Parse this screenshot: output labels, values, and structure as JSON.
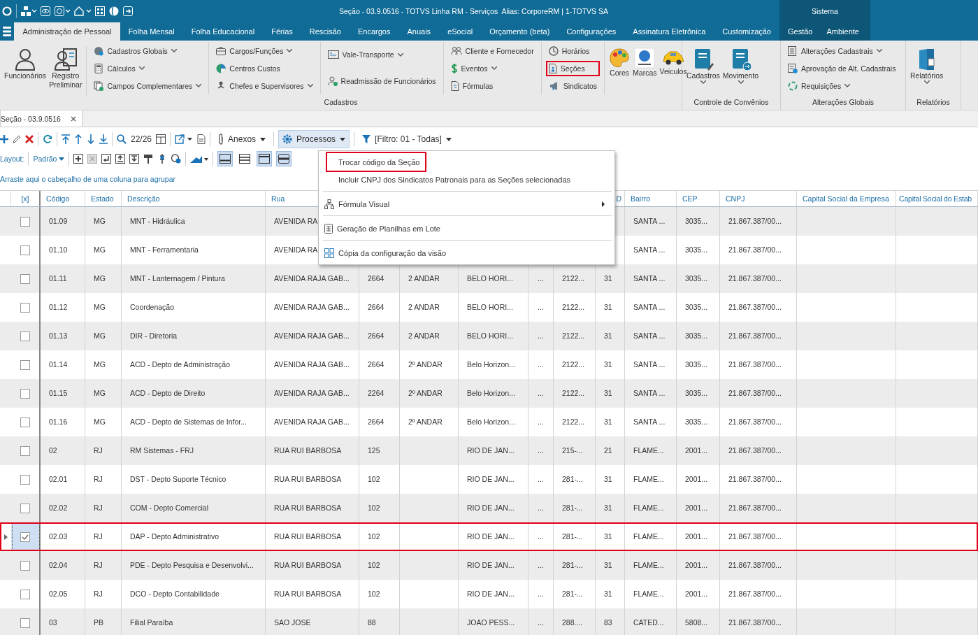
{
  "title_bar": {
    "title": "Seção - 03.9.0516 - TOTVS Linha RM - Serviços  Alias: CorporeRM | 1-TOTVS SA",
    "system_label": "Sistema"
  },
  "ribbon_tabs": [
    {
      "label": "Administração de Pessoal",
      "selected": true
    },
    {
      "label": "Folha Mensal",
      "selected": false
    },
    {
      "label": "Folha Educacional",
      "selected": false
    },
    {
      "label": "Férias",
      "selected": false
    },
    {
      "label": "Rescisão",
      "selected": false
    },
    {
      "label": "Encargos",
      "selected": false
    },
    {
      "label": "Anuais",
      "selected": false
    },
    {
      "label": "eSocial",
      "selected": false
    },
    {
      "label": "Orçamento (beta)",
      "selected": false
    },
    {
      "label": "Configurações",
      "selected": false
    },
    {
      "label": "Assinatura Eletrônica",
      "selected": false
    },
    {
      "label": "Customização",
      "selected": false
    }
  ],
  "system_tabs": [
    {
      "label": "Gestão",
      "selected": false
    },
    {
      "label": "Ambiente",
      "selected": false
    }
  ],
  "ribbon_groups": [
    {
      "label": "Cadastros",
      "sections": [
        {
          "kind": "large",
          "items": [
            {
              "label": "Funcionários",
              "dropdown": false,
              "highlighted": false
            },
            {
              "label": "Registro Preliminar",
              "dropdown": false,
              "highlighted": false
            }
          ]
        },
        {
          "kind": "stack",
          "items": [
            {
              "label": "Cadastros Globais",
              "dropdown": true,
              "highlighted": false
            },
            {
              "label": "Cálculos",
              "dropdown": true,
              "highlighted": false
            },
            {
              "label": "Campos Complementares",
              "dropdown": true,
              "highlighted": false
            }
          ]
        },
        {
          "kind": "stack",
          "items": [
            {
              "label": "Cargos/Funções",
              "dropdown": true,
              "highlighted": false
            },
            {
              "label": "Centros Custos",
              "dropdown": false,
              "highlighted": false
            },
            {
              "label": "Chefes e Supervisores",
              "dropdown": true,
              "highlighted": false
            }
          ]
        },
        {
          "kind": "stack",
          "items": [
            {
              "label": "Vale-Transporte",
              "dropdown": true,
              "highlighted": false
            },
            {
              "label": "Readmissão de Funcionários",
              "dropdown": false,
              "highlighted": false
            }
          ]
        },
        {
          "kind": "stack",
          "items": [
            {
              "label": "Cliente e Fornecedor",
              "dropdown": false,
              "highlighted": false
            },
            {
              "label": "Eventos",
              "dropdown": true,
              "highlighted": false
            },
            {
              "label": "Fórmulas",
              "dropdown": false,
              "highlighted": false
            }
          ]
        },
        {
          "kind": "stack",
          "items": [
            {
              "label": "Horários",
              "dropdown": false,
              "highlighted": false
            },
            {
              "label": "Seções",
              "dropdown": false,
              "highlighted": true
            },
            {
              "label": "Sindicatos",
              "dropdown": false,
              "highlighted": false
            }
          ]
        },
        {
          "kind": "large",
          "items": [
            {
              "label": "Cores",
              "dropdown": false,
              "highlighted": false
            },
            {
              "label": "Marcas",
              "dropdown": false,
              "highlighted": false
            },
            {
              "label": "Veiculos",
              "dropdown": false,
              "highlighted": false
            }
          ]
        }
      ]
    },
    {
      "label": "Controle de Convênios",
      "sections": [
        {
          "kind": "large",
          "items": [
            {
              "label": "Cadastros",
              "dropdown": true,
              "highlighted": false
            },
            {
              "label": "Movimento",
              "dropdown": true,
              "highlighted": false
            }
          ]
        }
      ]
    },
    {
      "label": "Alterações Globais",
      "sections": [
        {
          "kind": "stack",
          "items": [
            {
              "label": "Alterações Cadastrais",
              "dropdown": true,
              "highlighted": false
            },
            {
              "label": "Aprovação de Alt. Cadastrais",
              "dropdown": false,
              "highlighted": false
            },
            {
              "label": "Requisições",
              "dropdown": true,
              "highlighted": false
            }
          ]
        }
      ]
    },
    {
      "label": "Relatórios",
      "sections": [
        {
          "kind": "large",
          "items": [
            {
              "label": "Relatórios",
              "dropdown": true,
              "highlighted": false
            }
          ]
        }
      ]
    }
  ],
  "document_tabs": [
    {
      "label": "Seção - 03.9.0516",
      "selected": true
    }
  ],
  "toolbar": {
    "record_counter": "22/26",
    "buttons": [
      {
        "label": "Anexos",
        "dropdown": true,
        "selected": false
      },
      {
        "label": "Processos",
        "dropdown": true,
        "selected": true
      },
      {
        "label": "[Filtro: 01 - Todas]",
        "dropdown": true,
        "selected": false
      }
    ]
  },
  "layout_bar": {
    "label": "Layout:",
    "preset": "Padrão",
    "view_toggles": [
      {
        "selected": true
      },
      {
        "selected": false
      },
      {
        "selected": true
      },
      {
        "selected": true
      }
    ]
  },
  "group_panel_hint": "Arraste aqui o cabeçalho de uma coluna para agrupar",
  "processes_menu": [
    {
      "kind": "item",
      "label": "Trocar código da Seção",
      "highlighted": true
    },
    {
      "kind": "item",
      "label": "Incluir CNPJ dos Sindicatos Patronais para as Seções selecionadas",
      "highlighted": false
    },
    {
      "kind": "separator"
    },
    {
      "kind": "submenu",
      "label": "Fórmula Visual",
      "highlighted": false
    },
    {
      "kind": "separator"
    },
    {
      "kind": "item",
      "label": "Geração de Planilhas em Lote",
      "highlighted": false
    },
    {
      "kind": "separator"
    },
    {
      "kind": "item",
      "label": "Cópia da configuração da visão",
      "highlighted": false
    }
  ],
  "table": {
    "select_column": "[x]",
    "columns": [
      "Código",
      "Estado",
      "Descrição",
      "Rua",
      null,
      null,
      null,
      null,
      null,
      "D",
      "Bairro",
      "CEP",
      "CNPJ",
      "Capital Social da Empresa",
      "Capital Social do Estab"
    ],
    "rows": [
      {
        "checked": false,
        "selected": false,
        "highlighted": false,
        "cells": [
          "01.09",
          "MG",
          "MNT - Hidráulica",
          "AVENIDA RA",
          null,
          null,
          null,
          null,
          null,
          null,
          "SANTA ...",
          "3035...",
          "21.867.387/00...",
          null,
          null
        ]
      },
      {
        "checked": false,
        "selected": false,
        "highlighted": false,
        "cells": [
          "01.10",
          "MG",
          "MNT - Ferramentaria",
          "AVENIDA RA",
          null,
          null,
          null,
          null,
          null,
          null,
          "SANTA ...",
          "3035...",
          "21.867.387/00...",
          null,
          null
        ]
      },
      {
        "checked": false,
        "selected": false,
        "highlighted": false,
        "cells": [
          "01.11",
          "MG",
          "MNT - Lanternagem / Pintura",
          "AVENIDA RAJA GAB...",
          "2664",
          "2 ANDAR",
          "BELO HORI...",
          "...",
          "2122...",
          "31",
          "SANTA ...",
          "3035...",
          "21.867.387/00...",
          null,
          null
        ]
      },
      {
        "checked": false,
        "selected": false,
        "highlighted": false,
        "cells": [
          "01.12",
          "MG",
          "Coordenação",
          "AVENIDA RAJA GAB...",
          "2664",
          "2 ANDAR",
          "BELO HORI...",
          "...",
          "2122...",
          "31",
          "SANTA ...",
          "3035...",
          "21.867.387/00...",
          null,
          null
        ]
      },
      {
        "checked": false,
        "selected": false,
        "highlighted": false,
        "cells": [
          "01.13",
          "MG",
          "DIR - Diretoria",
          "AVENIDA RAJA GAB...",
          "2664",
          "2 ANDAR",
          "BELO HORI...",
          "...",
          "2122...",
          "31",
          "SANTA ...",
          "3035...",
          "21.867.387/00...",
          null,
          null
        ]
      },
      {
        "checked": false,
        "selected": false,
        "highlighted": false,
        "cells": [
          "01.14",
          "MG",
          "ACD - Depto de Administração",
          "AVENIDA RAJA GAB...",
          "2664",
          "2º ANDAR",
          "Belo Horizon...",
          "...",
          "2122...",
          "31",
          "SANTA ...",
          "3035...",
          "21.867.387/00...",
          null,
          null
        ]
      },
      {
        "checked": false,
        "selected": false,
        "highlighted": false,
        "cells": [
          "01.15",
          "MG",
          "ACD - Depto de Direito",
          "AVENIDA RAJA GAB...",
          "2264",
          "2º ANDAR",
          "Belo Horizon...",
          "...",
          "2122...",
          "31",
          "SANTA ...",
          "3035...",
          "21.867.387/00...",
          null,
          null
        ]
      },
      {
        "checked": false,
        "selected": false,
        "highlighted": false,
        "cells": [
          "01.16",
          "MG",
          "ACD - Depto de Sistemas de Infor...",
          "AVENIDA RAJA GAB...",
          "2664",
          "2º ANDAR",
          "Belo Horizon...",
          "...",
          "2122...",
          "31",
          "SANTA ...",
          "3035...",
          "21.867.387/00...",
          null,
          null
        ]
      },
      {
        "checked": false,
        "selected": false,
        "highlighted": false,
        "cells": [
          "02",
          "RJ",
          "RM Sistemas - FRJ",
          "RUA RUI BARBOSA",
          "125",
          null,
          "RIO DE JAN...",
          "...",
          "215-...",
          "21",
          "FLAME...",
          "2001...",
          "21.867.387/00...",
          null,
          null
        ]
      },
      {
        "checked": false,
        "selected": false,
        "highlighted": false,
        "cells": [
          "02.01",
          "RJ",
          "DST - Depto Suporte Técnico",
          "RUA RUI BARBOSA",
          "102",
          null,
          "RIO DE JAN...",
          "...",
          "281-...",
          "31",
          "FLAME...",
          "2001...",
          "21.867.387/00...",
          null,
          null
        ]
      },
      {
        "checked": false,
        "selected": false,
        "highlighted": false,
        "cells": [
          "02.02",
          "RJ",
          "COM - Depto Comercial",
          "RUA RUI BARBOSA",
          "102",
          null,
          "RIO DE JAN...",
          "...",
          "281-...",
          "31",
          "FLAME...",
          "2001...",
          "21.867.387/00...",
          null,
          null
        ]
      },
      {
        "checked": true,
        "selected": true,
        "highlighted": true,
        "cells": [
          "02.03",
          "RJ",
          "DAP - Depto Administrativo",
          "RUA RUI BARBOSA",
          "102",
          null,
          "RIO DE JAN...",
          "...",
          "281-...",
          "31",
          "FLAME...",
          "2001...",
          "21.867.387/00...",
          null,
          null
        ]
      },
      {
        "checked": false,
        "selected": false,
        "highlighted": false,
        "cells": [
          "02.04",
          "RJ",
          "PDE - Depto Pesquisa e Desenvolvi...",
          "RUA RUI BARBOSA",
          "102",
          null,
          "RIO DE JAN...",
          "...",
          "281-...",
          "31",
          "FLAME...",
          "2001...",
          "21.867.387/00...",
          null,
          null
        ]
      },
      {
        "checked": false,
        "selected": false,
        "highlighted": false,
        "cells": [
          "02.05",
          "RJ",
          "DCO - Depto Contabilidade",
          "RUA RUI BARBOSA",
          "102",
          null,
          "RIO DE JAN...",
          "...",
          "281-...",
          "31",
          "FLAME...",
          "2001...",
          "21.867.387/00...",
          null,
          null
        ]
      },
      {
        "checked": false,
        "selected": false,
        "highlighted": false,
        "cells": [
          "03",
          "PB",
          "Filial Paraíba",
          "SAO JOSE",
          "88",
          null,
          "JOAO PESS...",
          "...",
          "288....",
          "83",
          "CATED...",
          "5808...",
          "21.867.387/00...",
          null,
          null
        ]
      }
    ]
  }
}
